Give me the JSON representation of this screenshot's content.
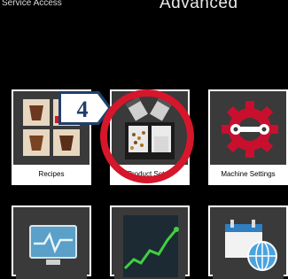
{
  "header": {
    "service_label": "Service Access",
    "title": "Advanced"
  },
  "tiles": [
    {
      "label": "Recipes",
      "icon": "recipes-icon"
    },
    {
      "label": "Product Setup",
      "icon": "product-setup-icon"
    },
    {
      "label": "Machine Settings",
      "icon": "machine-settings-icon"
    },
    {
      "label": "",
      "icon": "monitor-icon"
    },
    {
      "label": "",
      "icon": "statistics-chart-icon"
    },
    {
      "label": "",
      "icon": "calendar-globe-icon"
    }
  ],
  "annotation": {
    "step_number": "4",
    "callout_color": "#1f3f6a",
    "highlight_color": "#d5162b"
  }
}
